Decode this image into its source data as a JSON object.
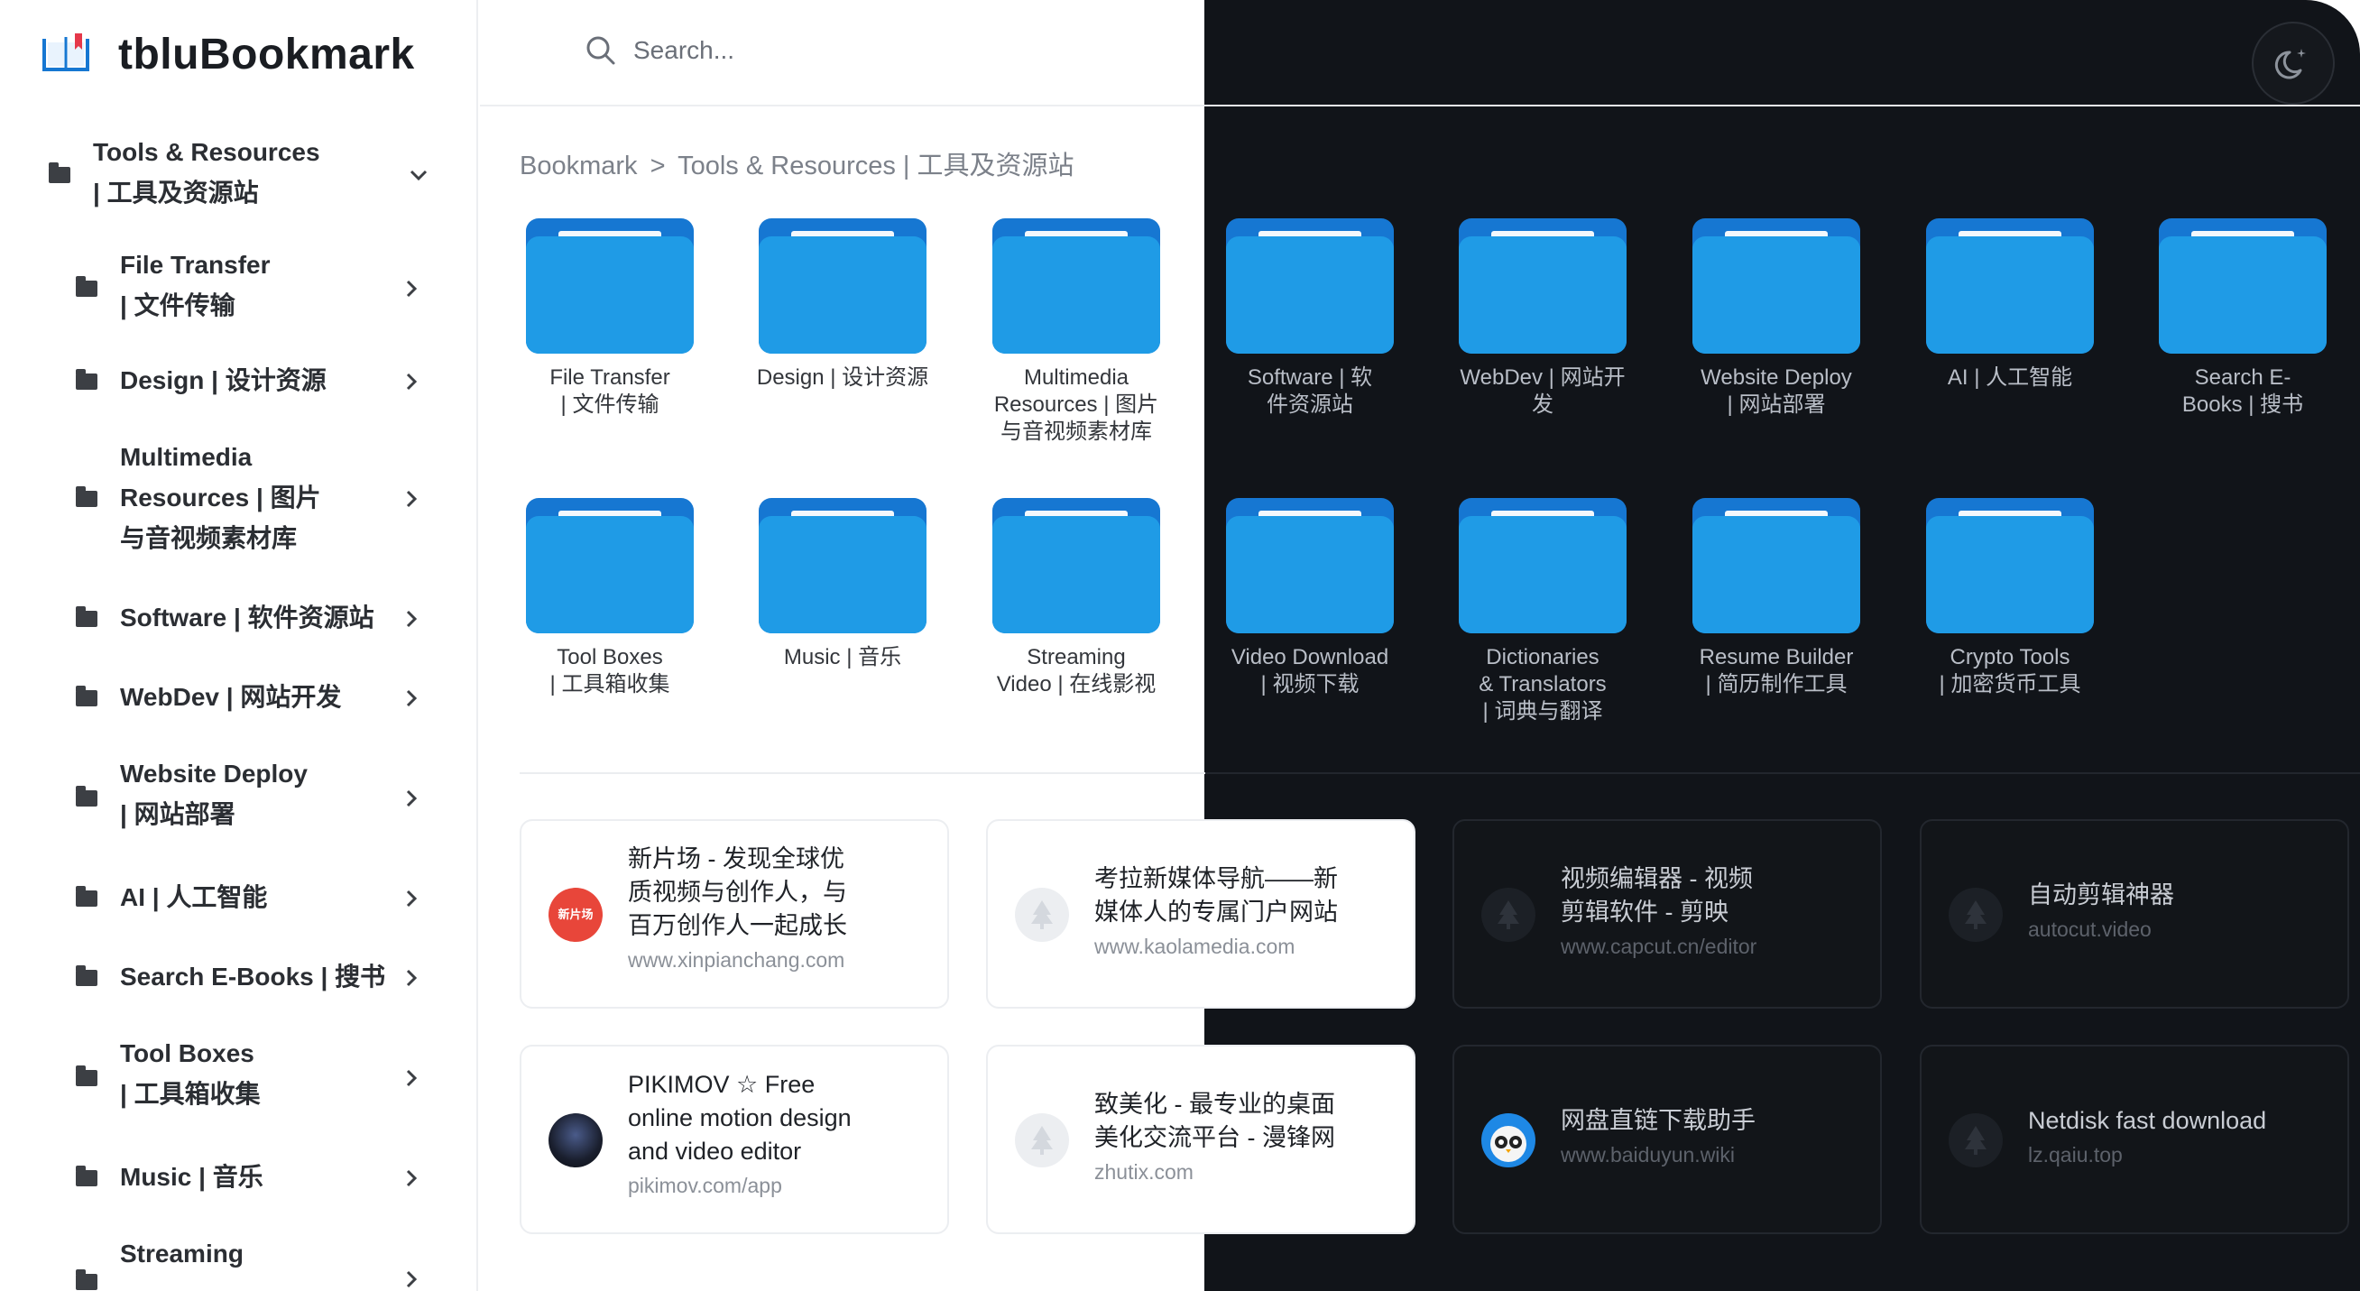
{
  "app": {
    "title": "tbluBookmark"
  },
  "search": {
    "placeholder": "Search..."
  },
  "breadcrumb": {
    "root": "Bookmark",
    "separator": ">",
    "current": "Tools & Resources | 工具及资源站"
  },
  "sidebar": {
    "top": {
      "line1": "Tools & Resources",
      "line2": "| 工具及资源站"
    },
    "items": [
      {
        "lines": [
          "File Transfer",
          "| 文件传输"
        ]
      },
      {
        "lines": [
          "Design | 设计资源"
        ]
      },
      {
        "lines": [
          "Multimedia",
          "Resources | 图片",
          "与音视频素材库"
        ]
      },
      {
        "lines": [
          "Software | 软件资源站"
        ]
      },
      {
        "lines": [
          "WebDev | 网站开发"
        ]
      },
      {
        "lines": [
          "Website Deploy",
          "| 网站部署"
        ]
      },
      {
        "lines": [
          "AI | 人工智能"
        ]
      },
      {
        "lines": [
          "Search E-Books | 搜书"
        ]
      },
      {
        "lines": [
          "Tool Boxes",
          "| 工具箱收集"
        ]
      },
      {
        "lines": [
          "Music | 音乐"
        ]
      },
      {
        "lines": [
          "Streaming"
        ]
      }
    ]
  },
  "folders": [
    {
      "lines": [
        "File Transfer",
        "| 文件传输"
      ]
    },
    {
      "lines": [
        "Design | 设计资源"
      ]
    },
    {
      "lines": [
        "Multimedia",
        "Resources | 图片",
        "与音视频素材库"
      ]
    },
    {
      "lines": [
        "Software | 软",
        "件资源站"
      ]
    },
    {
      "lines": [
        "WebDev | 网站开发"
      ]
    },
    {
      "lines": [
        "Website Deploy",
        "| 网站部署"
      ]
    },
    {
      "lines": [
        "AI | 人工智能"
      ]
    },
    {
      "lines": [
        "Search E-",
        "Books | 搜书"
      ]
    },
    {
      "lines": [
        "Tool Boxes",
        "| 工具箱收集"
      ]
    },
    {
      "lines": [
        "Music | 音乐"
      ]
    },
    {
      "lines": [
        "Streaming",
        "Video | 在线影视"
      ]
    },
    {
      "lines": [
        "Video Download",
        "| 视频下载"
      ]
    },
    {
      "lines": [
        "Dictionaries",
        "& Translators",
        "| 词典与翻译"
      ]
    },
    {
      "lines": [
        "Resume Builder",
        "| 简历制作工具"
      ]
    },
    {
      "lines": [
        "Crypto Tools",
        "| 加密货币工具"
      ]
    }
  ],
  "cards": [
    {
      "title_lines": [
        "新片场 - 发现全球优",
        "质视频与创作人，与",
        "百万创作人一起成长"
      ],
      "url": "www.xinpianchang.com",
      "icon": "xinpianchang-logo",
      "icon_text": "新片场"
    },
    {
      "title_lines": [
        "考拉新媒体导航——新",
        "媒体人的专属门户网站"
      ],
      "url": "www.kaolamedia.com",
      "icon": "tree-placeholder-icon"
    },
    {
      "title_lines": [
        "视频编辑器 - 视频",
        "剪辑软件 - 剪映"
      ],
      "url": "www.capcut.cn/editor",
      "icon": "tree-placeholder-icon"
    },
    {
      "title_lines": [
        "自动剪辑神器"
      ],
      "url": "autocut.video",
      "icon": "tree-placeholder-icon"
    },
    {
      "title_lines": [
        "PIKIMOV ☆ Free",
        "online motion design",
        "and video editor"
      ],
      "url": "pikimov.com/app",
      "icon": "pikimov-logo"
    },
    {
      "title_lines": [
        "致美化 - 最专业的桌面",
        "美化交流平台 - 漫锋网"
      ],
      "url": "zhutix.com",
      "icon": "tree-placeholder-icon"
    },
    {
      "title_lines": [
        "网盘直链下载助手"
      ],
      "url": "www.baiduyun.wiki",
      "icon": "owl-logo"
    },
    {
      "title_lines": [
        "Netdisk fast download"
      ],
      "url": "lz.qaiu.top",
      "icon": "tree-placeholder-icon"
    }
  ],
  "colors": {
    "folder": "#1f9be6",
    "folder_back": "#1677d2",
    "dark_bg": "#111419",
    "xinpianchang": "#e8463a"
  }
}
